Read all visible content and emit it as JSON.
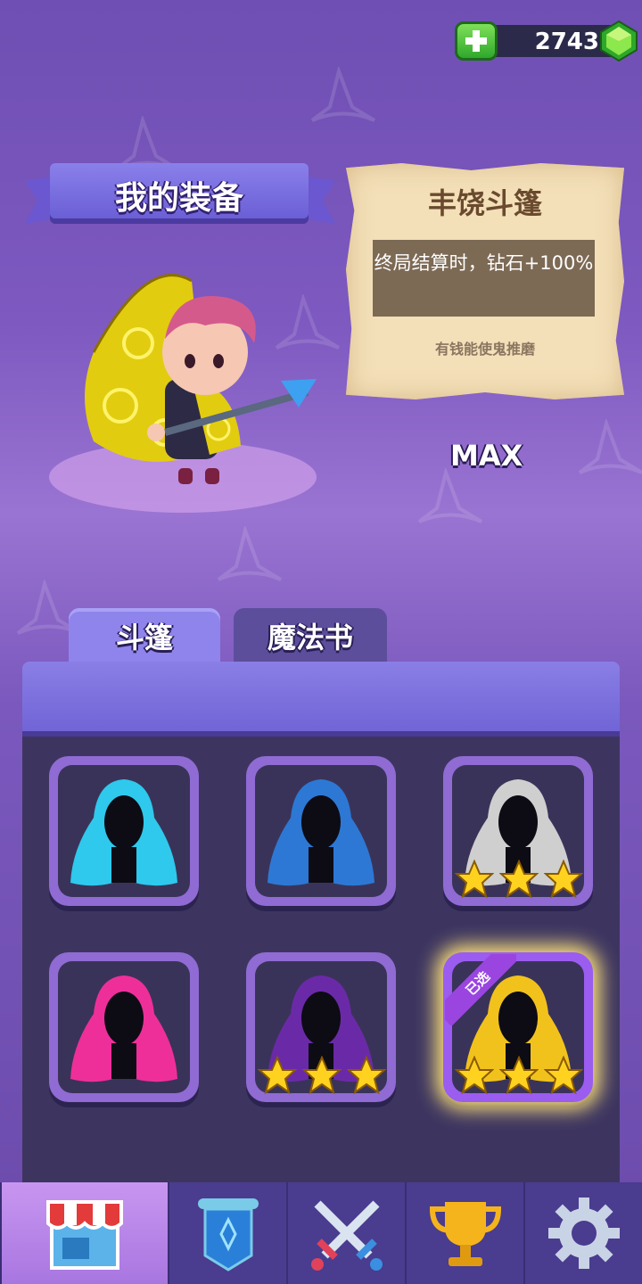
{
  "currency": {
    "amount": "2743",
    "plus_icon": "plus-icon",
    "gem_icon": "green-gem-icon"
  },
  "equipment": {
    "title": "我的装备",
    "max_label": "MAX"
  },
  "item_card": {
    "name": "丰饶斗篷",
    "description": "终局结算时，钻石+100%",
    "tagline": "有钱能使鬼推磨"
  },
  "tabs": [
    {
      "label": "斗篷",
      "active": true
    },
    {
      "label": "魔法书",
      "active": false
    }
  ],
  "capes": [
    {
      "name": "cyan-cape",
      "color": "#2ec9ec",
      "stars": 0
    },
    {
      "name": "blue-star-cape",
      "color": "#2d78d4",
      "stars": 0
    },
    {
      "name": "plaid-cape",
      "color": "#cfcfcf",
      "stars": 3
    },
    {
      "name": "pink-heart-cape",
      "color": "#ee2f9a",
      "stars": 0
    },
    {
      "name": "purple-star-cape",
      "color": "#6a2aa8",
      "stars": 3
    },
    {
      "name": "gold-swirl-cape",
      "color": "#f2c21c",
      "stars": 3,
      "selected": true,
      "badge": "已选"
    }
  ],
  "nav": [
    "shop-icon",
    "banner-icon",
    "swords-icon",
    "trophy-icon",
    "gear-icon"
  ]
}
